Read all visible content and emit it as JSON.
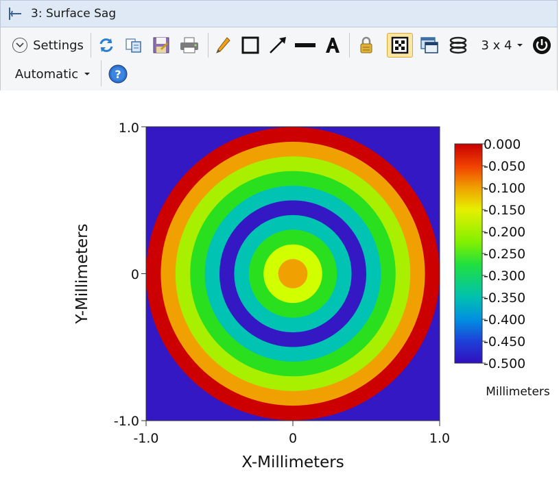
{
  "window": {
    "title": "3: Surface Sag"
  },
  "toolbar": {
    "settings_label": "Settings",
    "layout_label": "3 x 4",
    "mode_label": "Automatic",
    "icons": [
      "refresh-icon",
      "copy-icon",
      "save-icon",
      "print-icon",
      "pencil-icon",
      "rectangle-icon",
      "arrow-icon",
      "line-icon",
      "text-icon",
      "lock-icon",
      "fit-grid-icon",
      "window-icon",
      "layers-icon",
      "power-icon",
      "help-icon"
    ]
  },
  "chart_data": {
    "type": "heatmap",
    "xlabel": "X-Millimeters",
    "ylabel": "Y-Millimeters",
    "xlim": [
      -1.0,
      1.0
    ],
    "ylim": [
      -1.0,
      1.0
    ],
    "x_tick_labels": [
      "-1.0",
      "0",
      "1.0"
    ],
    "y_tick_labels": [
      "1.0",
      "0",
      "-1.0"
    ],
    "colorbar": {
      "unit_label": "Millimeters",
      "range": [
        -0.5,
        0.0
      ],
      "tick_labels": [
        "0.000",
        "-0.050",
        "-0.100",
        "-0.150",
        "-0.200",
        "-0.250",
        "-0.300",
        "-0.350",
        "-0.400",
        "-0.450",
        "-0.500"
      ]
    },
    "background_color": "#3318c4",
    "rings": [
      {
        "outer_radius_mm": 1.0,
        "color": "#cc0000"
      },
      {
        "outer_radius_mm": 0.9,
        "color": "#f0a000"
      },
      {
        "outer_radius_mm": 0.8,
        "color": "#a9f000"
      },
      {
        "outer_radius_mm": 0.7,
        "color": "#2ae01e"
      },
      {
        "outer_radius_mm": 0.6,
        "color": "#00c3b4"
      },
      {
        "outer_radius_mm": 0.5,
        "color": "#3318c4"
      },
      {
        "outer_radius_mm": 0.4,
        "color": "#00c3b4"
      },
      {
        "outer_radius_mm": 0.3,
        "color": "#2ae01e"
      },
      {
        "outer_radius_mm": 0.2,
        "color": "#d2ff00"
      },
      {
        "outer_radius_mm": 0.1,
        "color": "#f0a000"
      }
    ]
  }
}
